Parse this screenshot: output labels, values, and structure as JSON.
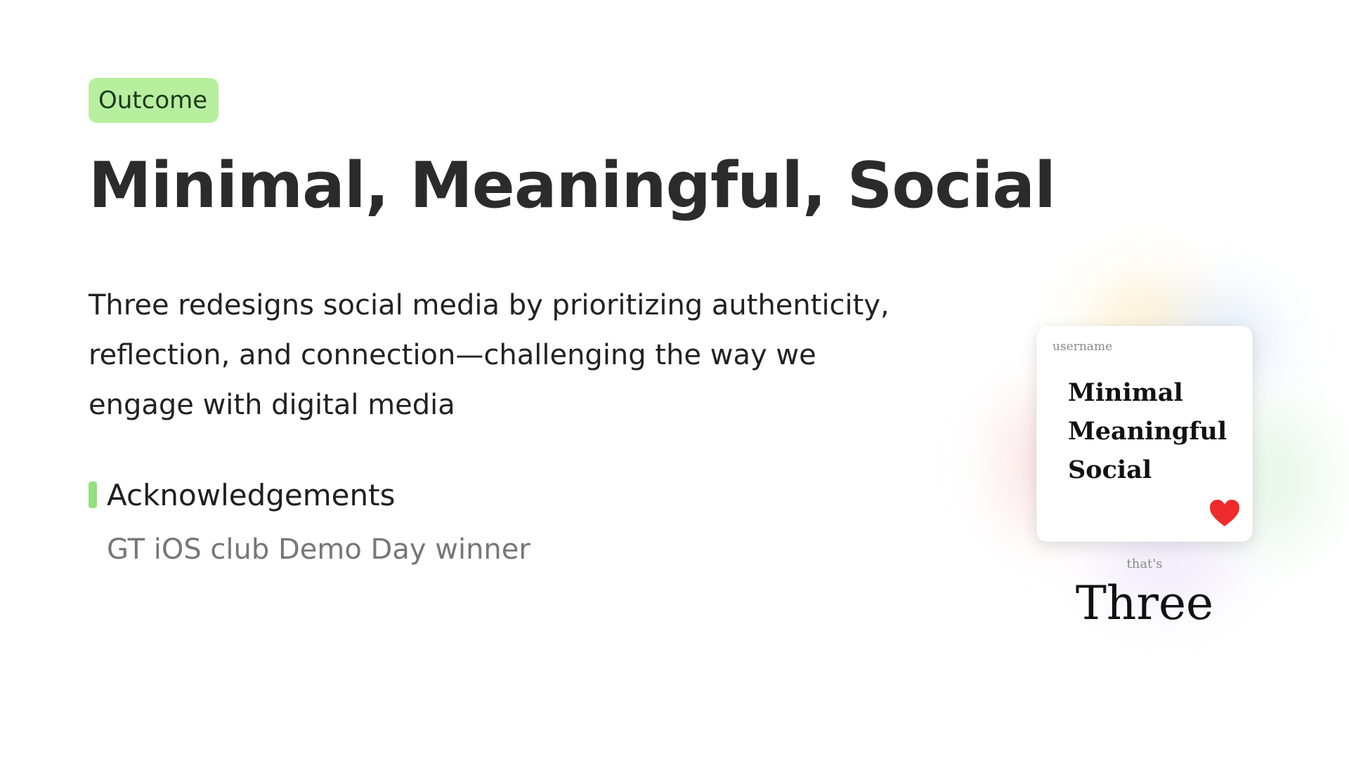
{
  "badge": {
    "label": "Outcome",
    "color": "#b7ef9f"
  },
  "title": "Minimal, Meaningful, Social",
  "description": "Three redesigns social media by prioritizing authenticity, reflection, and connection—challenging the way we engage with digital media",
  "acknowledgements": {
    "heading": "Acknowledgements",
    "accent_color": "#93e07c",
    "items": [
      "GT iOS club Demo Day winner"
    ]
  },
  "preview": {
    "username": "username",
    "lines": [
      "Minimal",
      "Meaningful",
      "Social"
    ],
    "heart_icon": "heart-icon",
    "heart_color": "#ef2b2b",
    "caption_small": "that's",
    "caption_large": "Three"
  }
}
